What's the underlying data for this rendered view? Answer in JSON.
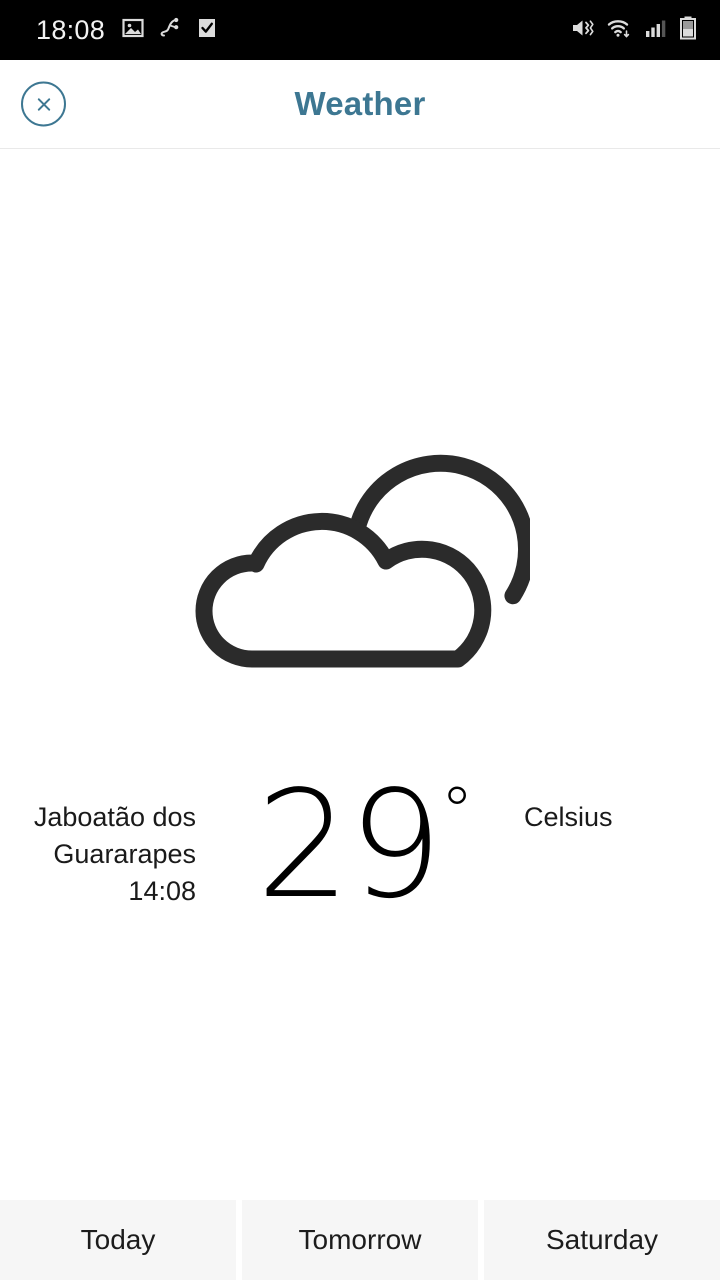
{
  "status_bar": {
    "clock": "18:08",
    "left_icons": [
      "image-icon",
      "music-note-icon",
      "checkbox-checked-icon"
    ],
    "right_icons": [
      "volume-mute-vibrate-icon",
      "wifi-icon",
      "cellular-signal-icon",
      "battery-icon"
    ],
    "background": "#000000",
    "foreground": "#f2f2f2",
    "battery_level_percent": 45,
    "signal_bars": 3
  },
  "header": {
    "title": "Weather",
    "title_color": "#3d7792",
    "close_icon": "close-circle-icon"
  },
  "current": {
    "condition_icon": "partly-cloudy-icon",
    "icon_color": "#2b2b2b",
    "location_line1": "Jaboatão dos",
    "location_line2": "Guararapes",
    "observation_time": "14:08",
    "temperature": "29",
    "degree_symbol": "°",
    "unit_label": "Celsius"
  },
  "day_tabs": {
    "tab_background": "#f6f6f6",
    "items": [
      {
        "label": "Today",
        "selected": true
      },
      {
        "label": "Tomorrow",
        "selected": false
      },
      {
        "label": "Saturday",
        "selected": false
      }
    ]
  }
}
